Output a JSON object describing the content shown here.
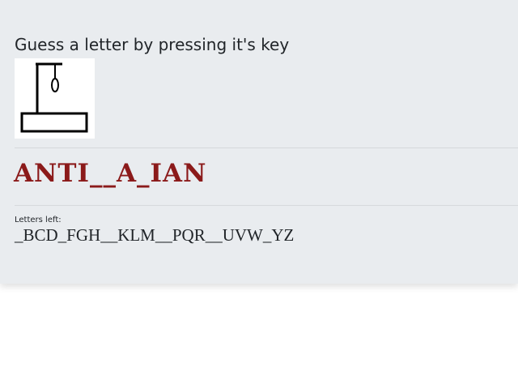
{
  "game": {
    "instruction": "Guess a letter by pressing it's key",
    "word_display": "ANTI__A_IAN",
    "letters_left_label": "Letters left:",
    "letters_left": "_BCD_FGH__KLM__PQR__UVW_YZ",
    "hangman_stage": 0
  },
  "colors": {
    "word": "#8b1a1a",
    "panel_background": "#e9ecef",
    "text": "#212529"
  }
}
